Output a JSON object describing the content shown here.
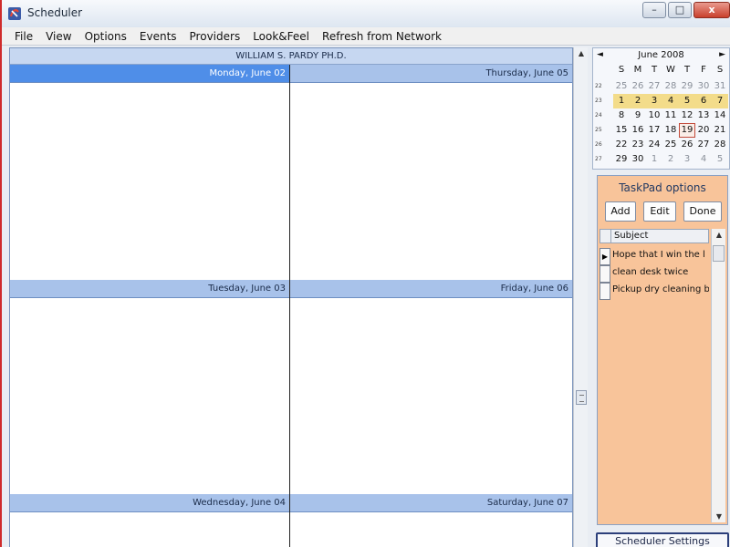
{
  "window": {
    "title": "Scheduler",
    "controls": {
      "minimize": "–",
      "maximize": "□",
      "close": "x"
    }
  },
  "menu": {
    "items": [
      "File",
      "View",
      "Options",
      "Events",
      "Providers",
      "Look&Feel",
      "Refresh from Network"
    ]
  },
  "calendar": {
    "provider": "WILLIAM S. PARDY PH.D.",
    "days": [
      {
        "label": "Monday, June 02",
        "selected": true
      },
      {
        "label": "Thursday, June 05",
        "selected": false
      },
      {
        "label": "Tuesday, June 03",
        "selected": false
      },
      {
        "label": "Friday, June 06",
        "selected": false
      },
      {
        "label": "Wednesday, June 04",
        "selected": false
      },
      {
        "label": "Saturday, June 07",
        "selected": false
      }
    ]
  },
  "mini_calendar": {
    "title": "June 2008",
    "prev": "◄",
    "next": "►",
    "weekdays": [
      "S",
      "M",
      "T",
      "W",
      "T",
      "F",
      "S"
    ],
    "week_numbers": [
      "22",
      "23",
      "24",
      "25",
      "26",
      "27"
    ],
    "weeks": [
      [
        "25",
        "26",
        "27",
        "28",
        "29",
        "30",
        "31"
      ],
      [
        "1",
        "2",
        "3",
        "4",
        "5",
        "6",
        "7"
      ],
      [
        "8",
        "9",
        "10",
        "11",
        "12",
        "13",
        "14"
      ],
      [
        "15",
        "16",
        "17",
        "18",
        "19",
        "20",
        "21"
      ],
      [
        "22",
        "23",
        "24",
        "25",
        "26",
        "27",
        "28"
      ],
      [
        "29",
        "30",
        "1",
        "2",
        "3",
        "4",
        "5"
      ]
    ],
    "today": "19"
  },
  "taskpad": {
    "title": "TaskPad options",
    "buttons": {
      "add": "Add",
      "edit": "Edit",
      "done": "Done"
    },
    "column_header": "Subject",
    "tasks": [
      {
        "subject": "Hope that I win the l",
        "current": true
      },
      {
        "subject": "clean desk twice",
        "current": false
      },
      {
        "subject": "Pickup dry cleaning b",
        "current": false
      }
    ]
  },
  "settings": {
    "label": "Scheduler Settings"
  },
  "colors": {
    "selected_day_header": "#4f8ee8",
    "day_header": "#a8c2ea",
    "taskpad_bg": "#f8c49a",
    "current_week_highlight": "#f3dc8a"
  },
  "icons": {
    "app": "scheduler-app-icon",
    "current_row": "▶"
  }
}
